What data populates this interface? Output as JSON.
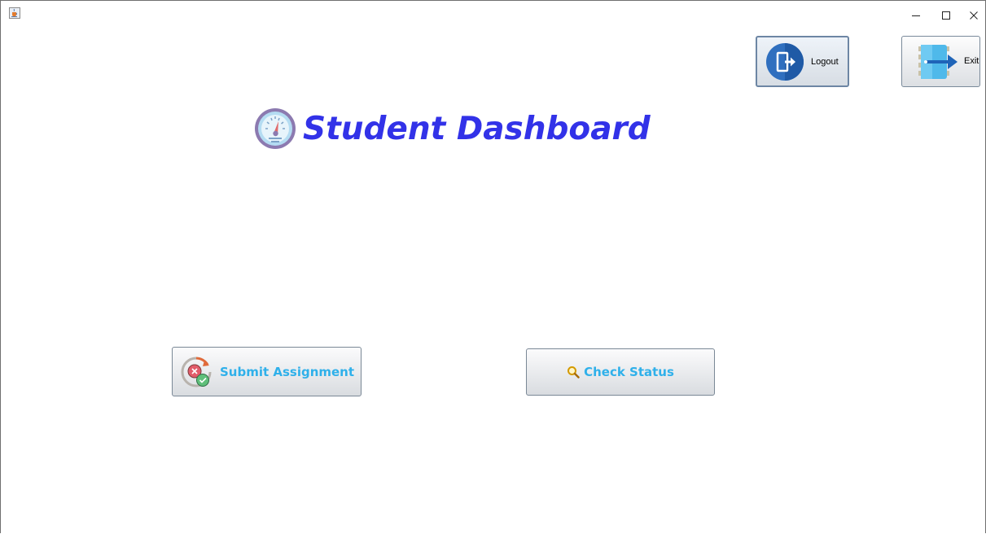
{
  "window": {
    "app_icon": "java-cup-icon",
    "controls": {
      "minimize_icon": "minimize-icon",
      "maximize_icon": "maximize-icon",
      "close_icon": "close-icon"
    }
  },
  "header": {
    "title": "Student Dashboard",
    "title_icon": "speedometer-icon",
    "title_color": "#3232e8"
  },
  "toolbar": {
    "logout_label": "Logout",
    "logout_icon": "logout-door-icon",
    "exit_label": "Exit",
    "exit_icon": "exit-arrow-icon"
  },
  "actions": {
    "submit_label": "Submit Assignment",
    "submit_icon": "submit-cycle-icon",
    "status_label": "Check Status",
    "status_icon": "magnifier-icon",
    "label_color": "#2fb0ea"
  }
}
